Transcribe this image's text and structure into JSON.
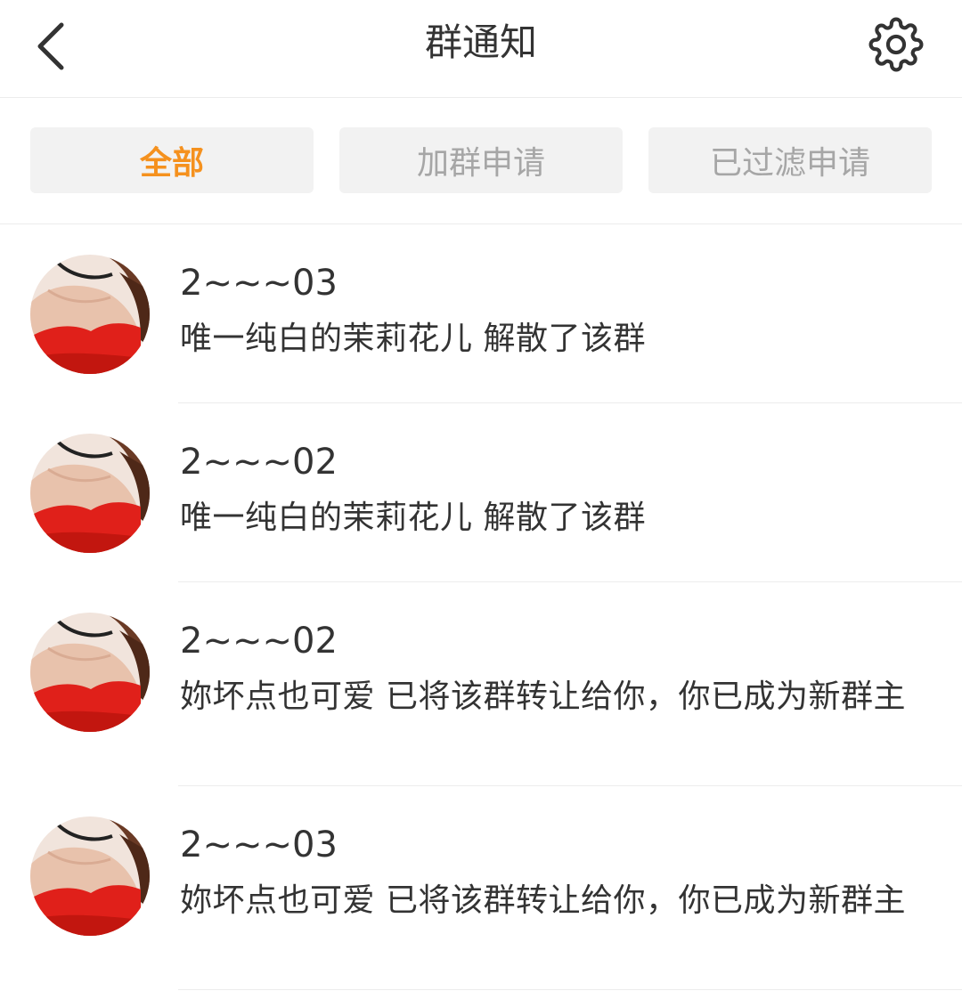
{
  "header": {
    "title": "群通知",
    "back_icon": "chevron-left-icon",
    "settings_icon": "gear-icon"
  },
  "tabs": [
    {
      "label": "全部",
      "active": true
    },
    {
      "label": "加群申请",
      "active": false
    },
    {
      "label": "已过滤申请",
      "active": false
    }
  ],
  "colors": {
    "accent": "#f5911e",
    "tab_bg": "#f2f2f2",
    "tab_inactive_text": "#a6a6a6",
    "text": "#333333",
    "divider": "#ececec"
  },
  "notifications": [
    {
      "name": "2~~~03",
      "message": "唯一纯白的茉莉花儿 解散了该群"
    },
    {
      "name": "2~~~02",
      "message": "唯一纯白的茉莉花儿 解散了该群"
    },
    {
      "name": "2~~~02",
      "message": "妳坏点也可爱 已将该群转让给你，你已成为新群主"
    },
    {
      "name": "2~~~03",
      "message": "妳坏点也可爱 已将该群转让给你，你已成为新群主"
    }
  ]
}
